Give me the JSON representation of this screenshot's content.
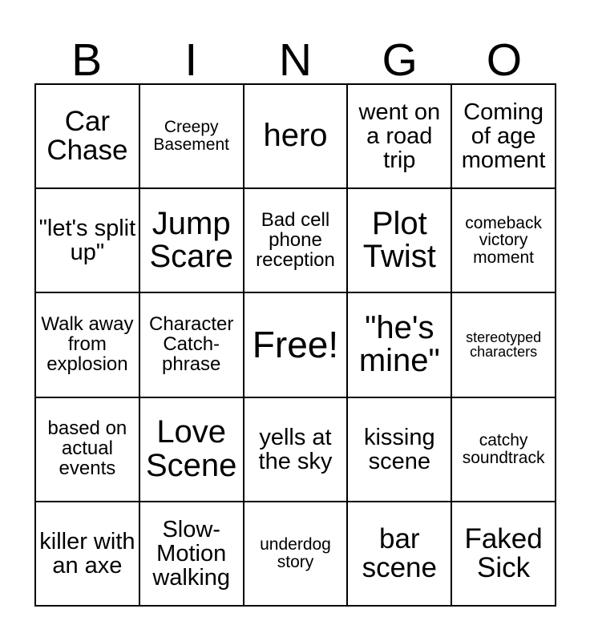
{
  "card": {
    "header_letters": [
      "B",
      "I",
      "N",
      "G",
      "O"
    ],
    "free_space_label": "Free!",
    "grid_line_color": "#000000",
    "background_color": "#ffffff",
    "text_color": "#000000",
    "columns": 5,
    "rows": 5,
    "cells": [
      {
        "text": "Car Chase",
        "size": "lg"
      },
      {
        "text": "Creepy Basement",
        "size": "xs"
      },
      {
        "text": "hero",
        "size": "xl"
      },
      {
        "text": "went on a road trip",
        "size": "md"
      },
      {
        "text": "Coming of age moment",
        "size": "md"
      },
      {
        "text": "\"let's split up\"",
        "size": "md"
      },
      {
        "text": "Jump Scare",
        "size": "xl"
      },
      {
        "text": "Bad cell phone reception",
        "size": "sm"
      },
      {
        "text": "Plot Twist",
        "size": "xl"
      },
      {
        "text": "comeback victory moment",
        "size": "xs"
      },
      {
        "text": "Walk away from explosion",
        "size": "sm"
      },
      {
        "text": "Character Catch-phrase",
        "size": "sm"
      },
      {
        "text": "Free!",
        "size": "xxl"
      },
      {
        "text": "\"he's mine\"",
        "size": "xl"
      },
      {
        "text": "stereotyped characters",
        "size": "xxs"
      },
      {
        "text": "based on actual events",
        "size": "sm"
      },
      {
        "text": "Love Scene",
        "size": "xl"
      },
      {
        "text": "yells at the sky",
        "size": "md"
      },
      {
        "text": "kissing scene",
        "size": "md"
      },
      {
        "text": "catchy soundtrack",
        "size": "xs"
      },
      {
        "text": "killer with an axe",
        "size": "md"
      },
      {
        "text": "Slow-Motion walking",
        "size": "md"
      },
      {
        "text": "underdog story",
        "size": "xs"
      },
      {
        "text": "bar scene",
        "size": "lg"
      },
      {
        "text": "Faked Sick",
        "size": "lg"
      }
    ]
  }
}
